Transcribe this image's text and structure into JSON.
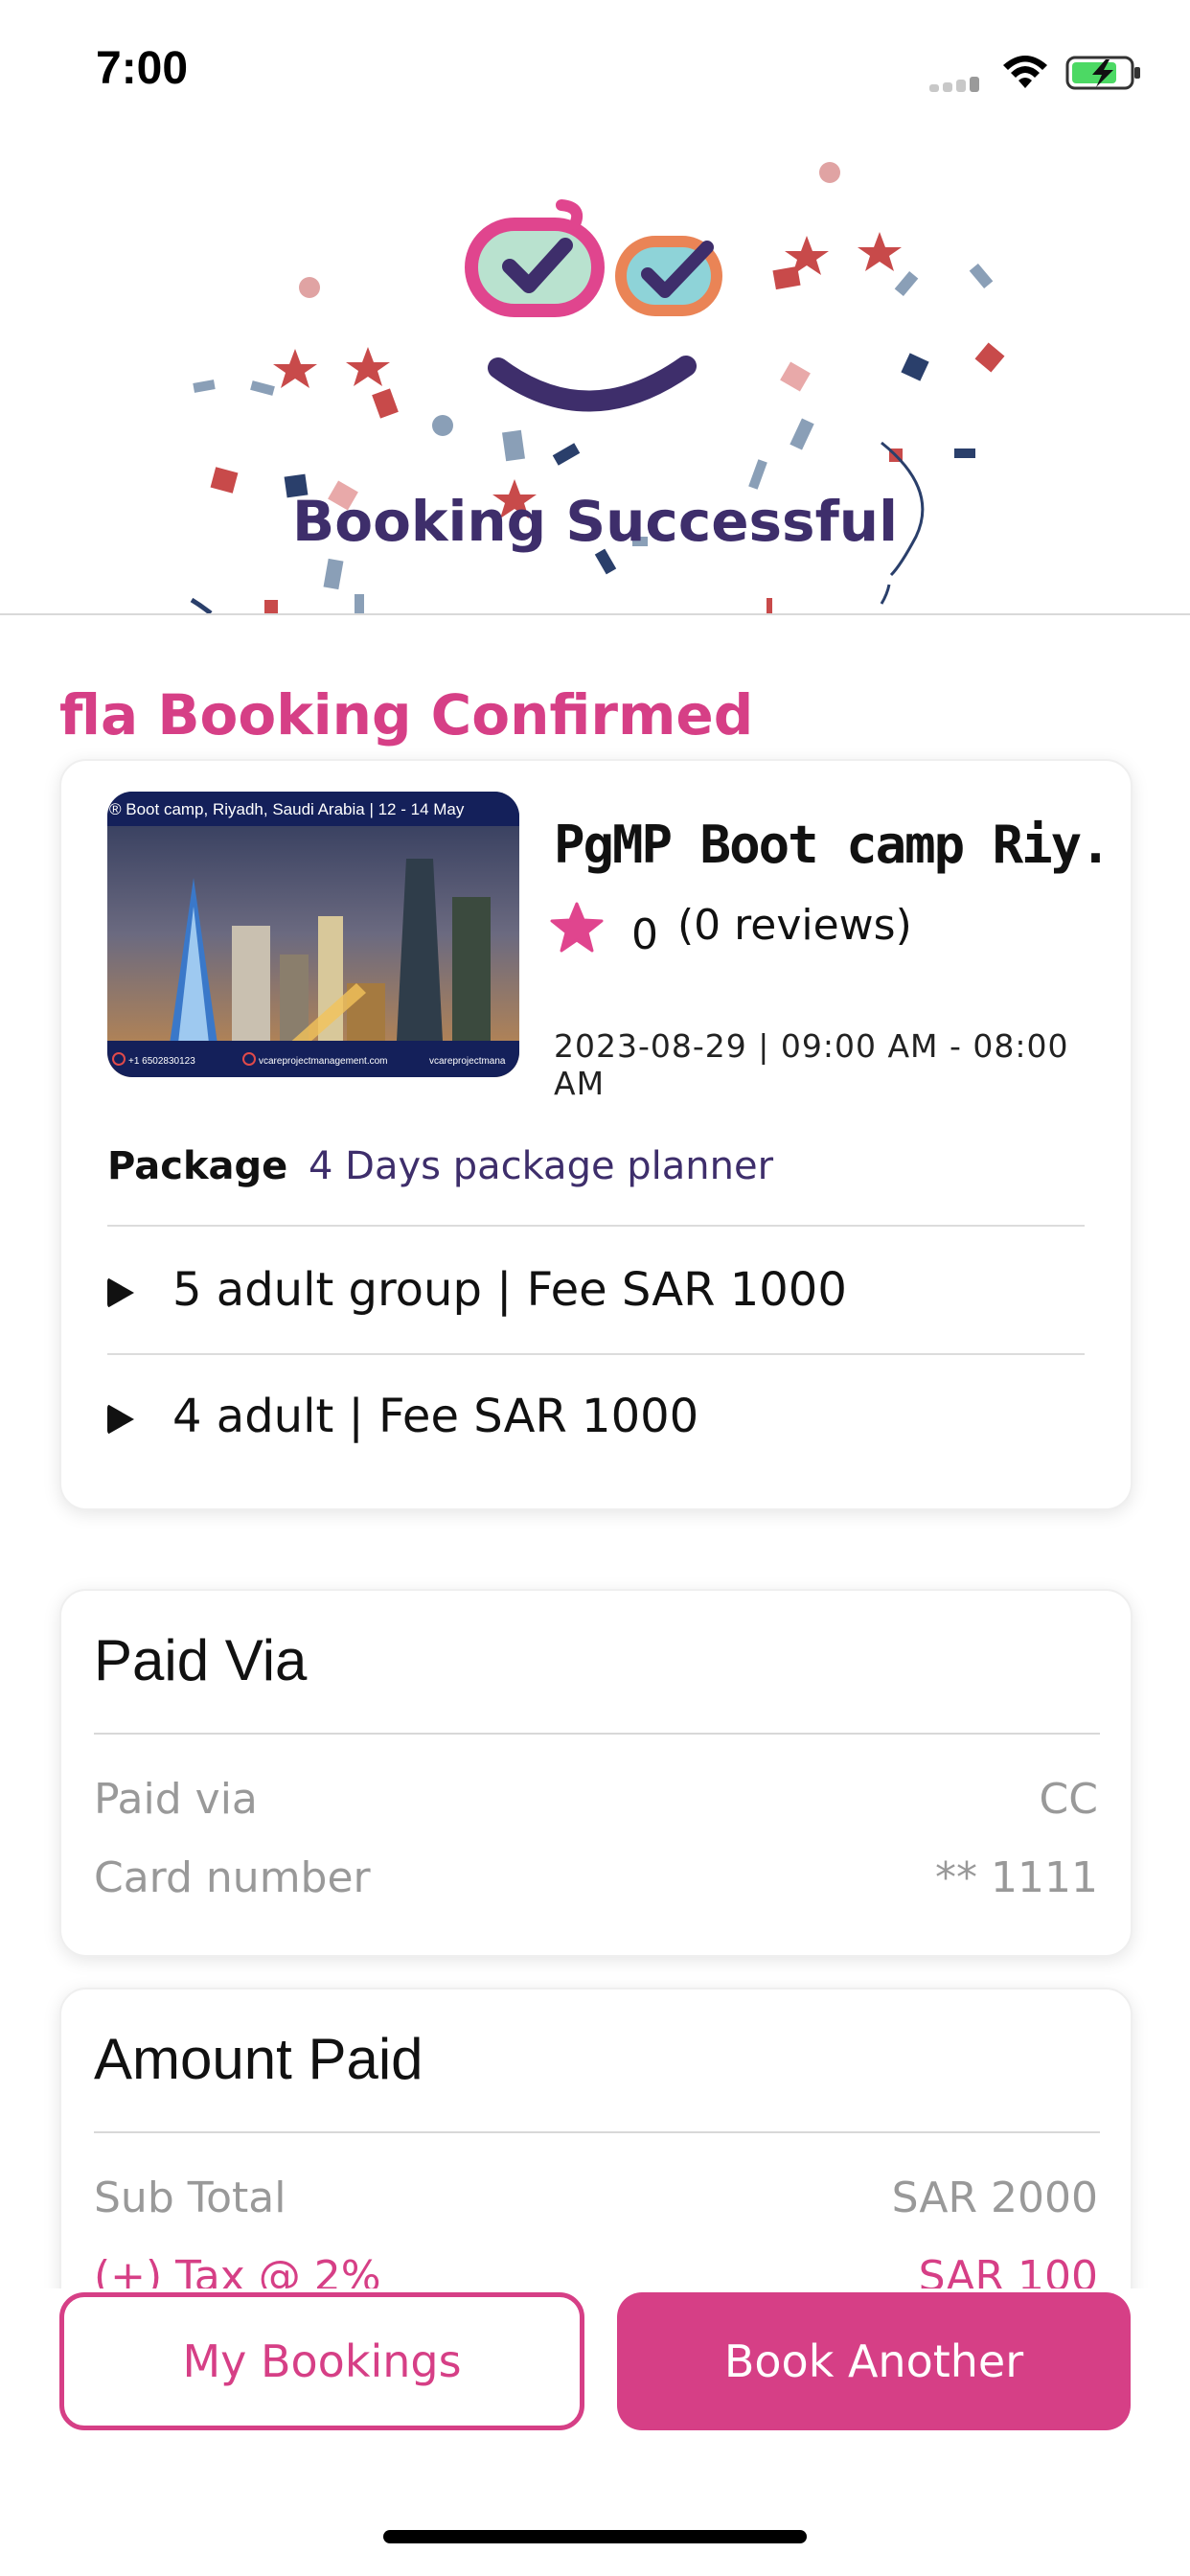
{
  "status": {
    "time": "7:00"
  },
  "hero": {
    "title": "Booking Successful"
  },
  "confirmation": {
    "title": "fla Booking Confirmed"
  },
  "event": {
    "name": "PgMP Boot camp Riy...",
    "thumbnail_banner": "® Boot camp, Riyadh, Saudi Arabia | 12 - 14 May",
    "thumbnail_footer_left": "+1 6502830123",
    "thumbnail_footer_mid": "vcareprojectmanagement.com",
    "thumbnail_footer_right": "vcareprojectmana",
    "rating": "0",
    "reviews": "(0 reviews)",
    "date": "2023-08-29 | 09:00 AM - 08:00 AM",
    "package_label": "Package",
    "package_value": "4 Days package planner",
    "options": [
      {
        "label": "5 adult group | Fee SAR 1000"
      },
      {
        "label": "4 adult | Fee SAR 1000"
      }
    ]
  },
  "paid_via": {
    "title": "Paid Via",
    "method_label": "Paid via",
    "method_value": "CC",
    "card_label": "Card number",
    "card_value": "** 1111"
  },
  "amount": {
    "title": "Amount Paid",
    "subtotal_label": "Sub Total",
    "subtotal_value": "SAR 2000",
    "tax_label": "(+) Tax @ 2%",
    "tax_value": "SAR 100"
  },
  "actions": {
    "my_bookings": "My Bookings",
    "book_another": "Book Another"
  },
  "colors": {
    "accent": "#d63f86",
    "title_purple": "#3e2e6b"
  },
  "icons": [
    "cellular-signal-icon",
    "wifi-icon",
    "battery-charging-icon",
    "star-icon",
    "play-triangle-icon",
    "success-mascot-icon"
  ]
}
